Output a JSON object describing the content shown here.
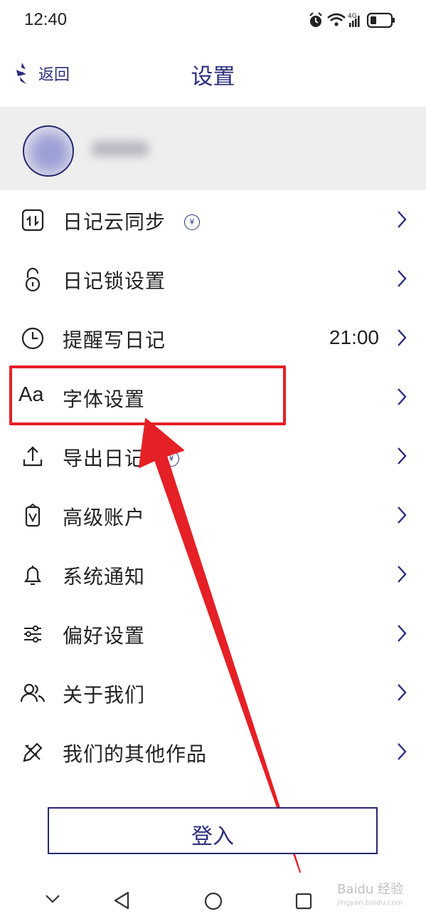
{
  "status_bar": {
    "time": "12:40",
    "icons": [
      "alarm-icon",
      "wifi-icon",
      "signal-4g-icon",
      "battery-icon"
    ],
    "network": "4G"
  },
  "header": {
    "back_label": "返回",
    "title": "设置"
  },
  "profile": {
    "avatar": "blurred-avatar",
    "name": "blurred"
  },
  "menu": [
    {
      "label": "日记云同步",
      "icon": "cloud-sync-icon",
      "premium": "¥"
    },
    {
      "label": "日记锁设置",
      "icon": "lock-icon"
    },
    {
      "label": "提醒写日记",
      "icon": "clock-icon",
      "value": "21:00"
    },
    {
      "label": "字体设置",
      "icon": "font-icon",
      "icon_text": "Aa"
    },
    {
      "label": "导出日记",
      "icon": "export-icon",
      "premium": "¥"
    },
    {
      "label": "高级账户",
      "icon": "vip-icon"
    },
    {
      "label": "系统通知",
      "icon": "bell-icon"
    },
    {
      "label": "偏好设置",
      "icon": "sliders-icon"
    },
    {
      "label": "关于我们",
      "icon": "people-icon"
    },
    {
      "label": "我们的其他作品",
      "icon": "pencil-ruler-icon"
    }
  ],
  "login_label": "登入",
  "system_nav": [
    "collapse-icon",
    "back-icon",
    "home-icon",
    "recents-icon"
  ],
  "watermark": {
    "text": "Baidu 经验",
    "sub": "jingyan.baidu.com"
  },
  "colors": {
    "accent": "#2b2e7c",
    "highlight": "#e52026",
    "profile_bg": "#eeeeee"
  }
}
